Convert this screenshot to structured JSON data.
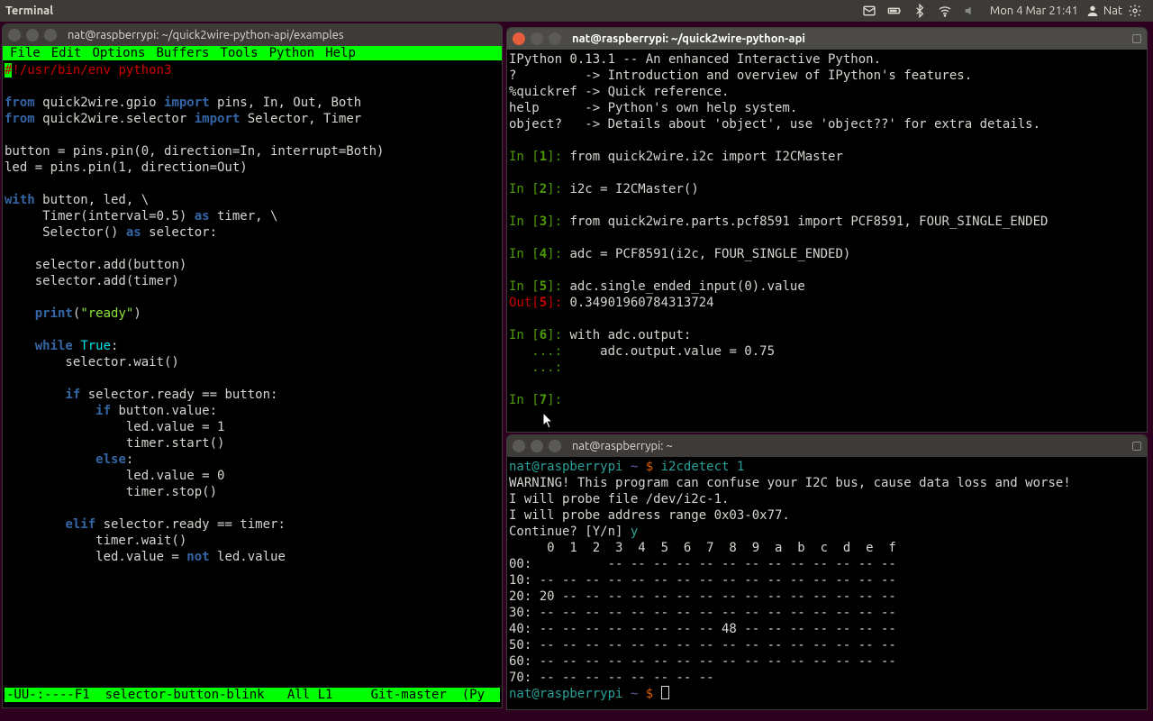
{
  "panel": {
    "app_title": "Terminal",
    "clock": "Mon 4 Mar 21:41",
    "user": "Nat"
  },
  "win_emacs": {
    "title": "nat@raspberrypi: ~/quick2wire-python-api/examples",
    "menubar": [
      "File",
      "Edit",
      "Options",
      "Buffers",
      "Tools",
      "Python",
      "Help"
    ],
    "shebang_hash": "#",
    "shebang_rest": "!/usr/bin/env python3",
    "kw_from": "from",
    "kw_import": "import",
    "kw_with": "with",
    "kw_as": "as",
    "kw_while": "while",
    "kw_true": "True",
    "kw_if": "if",
    "kw_elif": "elif",
    "kw_else": "else",
    "kw_not": "not",
    "imp1_mod": " quick2wire.gpio ",
    "imp1_syms": " pins, In, Out, Both",
    "imp2_mod": " quick2wire.selector ",
    "imp2_syms": " Selector, Timer",
    "l_button": "button = pins.pin(0, direction=In, interrupt=Both)",
    "l_led": "led = pins.pin(1, direction=Out)",
    "with1_a": " button, led, \\",
    "with2_a": "     Timer(interval=0.5) ",
    "with2_b": " timer, \\",
    "with3_a": "     Selector() ",
    "with3_b": " selector:",
    "l_addbtn": "    selector.add(button)",
    "l_addtmr": "    selector.add(timer)",
    "l_print_a": "    ",
    "l_print_fn": "print",
    "l_print_b": "(",
    "l_print_str": "\"ready\"",
    "l_print_c": ")",
    "while_b": ":",
    "l_wait": "        selector.wait()",
    "if_b": " selector.ready == button:",
    "if2_b": " button.value:",
    "l_led1": "                led.value = 1",
    "l_tstart": "                timer.start()",
    "else_b": ":",
    "l_led0": "                led.value = 0",
    "l_tstop": "                timer.stop()",
    "elif_b": " selector.ready == timer:",
    "l_twait": "            timer.wait()",
    "l_lednot_a": "            led.value = ",
    "l_lednot_b": " led.value",
    "modeline": "-UU-:----F1  selector-button-blink   All L1     Git-master  (Py"
  },
  "win_ipy": {
    "title": "nat@raspberrypi: ~/quick2wire-python-api",
    "hdr1": "IPython 0.13.1 -- An enhanced Interactive Python.",
    "hdr2a": "?         -> Introduction and overview of IPython's features.",
    "hdr3": "%quickref -> Quick reference.",
    "hdr4": "help      -> Python's own help system.",
    "hdr5": "object?   -> Details about 'object', use 'object??' for extra details.",
    "in": "In [",
    "inend": "]: ",
    "out": "Out[",
    "outend": "]: ",
    "n1": "1",
    "c1": "from quick2wire.i2c import I2CMaster",
    "n2": "2",
    "c2": "i2c = I2CMaster()",
    "n3": "3",
    "c3": "from quick2wire.parts.pcf8591 import PCF8591, FOUR_SINGLE_ENDED",
    "n4": "4",
    "c4": "adc = PCF8591(i2c, FOUR_SINGLE_ENDED)",
    "n5": "5",
    "c5": "adc.single_ended_input(0).value",
    "o5": "0.34901960784313724",
    "n6": "6",
    "c6": "with adc.output:",
    "cont": "   ...: ",
    "c6b": "    adc.output.value = 0.75",
    "n7": "7"
  },
  "win_sh": {
    "title": "nat@raspberrypi: ~",
    "p_user": "nat@raspberrypi",
    "p_sep": " ",
    "p_path": "~",
    "p_sym": " $ ",
    "cmd": "i2cdetect 1",
    "warn": "WARNING! This program can confuse your I2C bus, cause data loss and worse!",
    "l2": "I will probe file /dev/i2c-1.",
    "l3": "I will probe address range 0x03-0x77.",
    "l4a": "Continue? [Y/n] ",
    "l4b": "y",
    "hdr": "     0  1  2  3  4  5  6  7  8  9  a  b  c  d  e  f",
    "r00": "00:          -- -- -- -- -- -- -- -- -- -- -- -- --",
    "r10": "10: -- -- -- -- -- -- -- -- -- -- -- -- -- -- -- --",
    "r20": "20: 20 -- -- -- -- -- -- -- -- -- -- -- -- -- -- --",
    "r30": "30: -- -- -- -- -- -- -- -- -- -- -- -- -- -- -- --",
    "r40": "40: -- -- -- -- -- -- -- -- 48 -- -- -- -- -- -- --",
    "r50": "50: -- -- -- -- -- -- -- -- -- -- -- -- -- -- -- --",
    "r60": "60: -- -- -- -- -- -- -- -- -- -- -- -- -- -- -- --",
    "r70": "70: -- -- -- -- -- -- -- --"
  }
}
